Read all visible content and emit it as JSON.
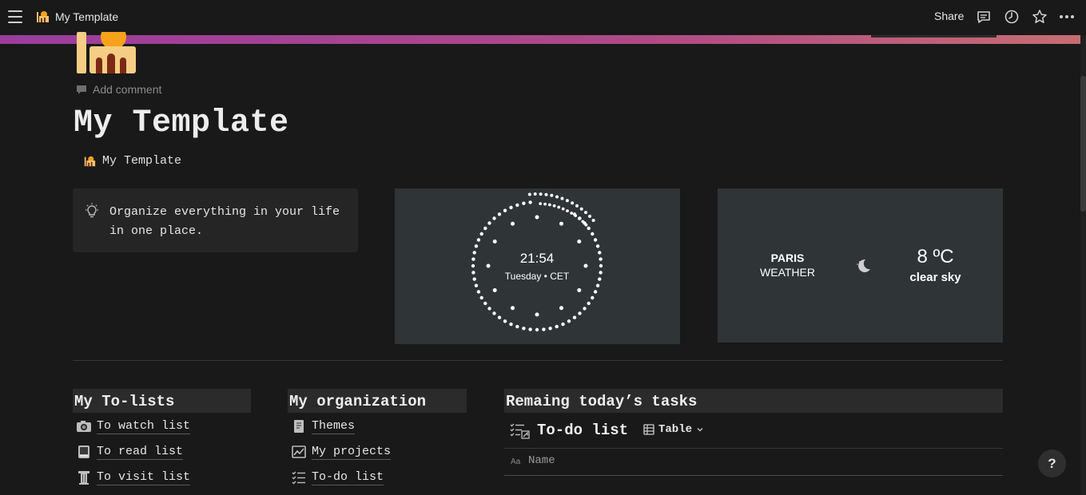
{
  "topbar": {
    "title": "My Template",
    "share_label": "Share",
    "icons": [
      "menu-icon",
      "comment-icon",
      "history-icon",
      "star-icon",
      "more-icon"
    ]
  },
  "page": {
    "add_comment": "Add comment",
    "title": "My Template",
    "breadcrumb_link": "My Template",
    "icon": "mosque-icon"
  },
  "callout": {
    "icon": "lightbulb-icon",
    "text": "Organize everything in your life in one place."
  },
  "clock": {
    "time": "21:54",
    "date": "Tuesday • CET"
  },
  "weather": {
    "city": "PARIS",
    "label": "WEATHER",
    "temp": "8 ºC",
    "description": "clear sky",
    "icon": "moon-cloud-icon"
  },
  "columns": {
    "todo_lists": {
      "heading": "My To-lists",
      "items": [
        {
          "label": "To watch list",
          "icon": "camera-icon"
        },
        {
          "label": "To read list",
          "icon": "book-icon"
        },
        {
          "label": "To visit list",
          "icon": "pillar-icon"
        }
      ]
    },
    "organization": {
      "heading": "My organization",
      "items": [
        {
          "label": "Themes",
          "icon": "scroll-icon"
        },
        {
          "label": "My projects",
          "icon": "chart-icon"
        },
        {
          "label": "To-do list",
          "icon": "checklist-icon"
        }
      ]
    },
    "tasks": {
      "heading": "Remaing today’s tasks",
      "db_title": "To-do list",
      "view_label": "Table",
      "column_name": "Name"
    }
  },
  "help": {
    "label": "?"
  },
  "colors": {
    "background": "#191919",
    "widget": "#2f3437",
    "callout": "#252525",
    "cover_start": "#9a3d9d",
    "cover_end": "#c66d72"
  }
}
